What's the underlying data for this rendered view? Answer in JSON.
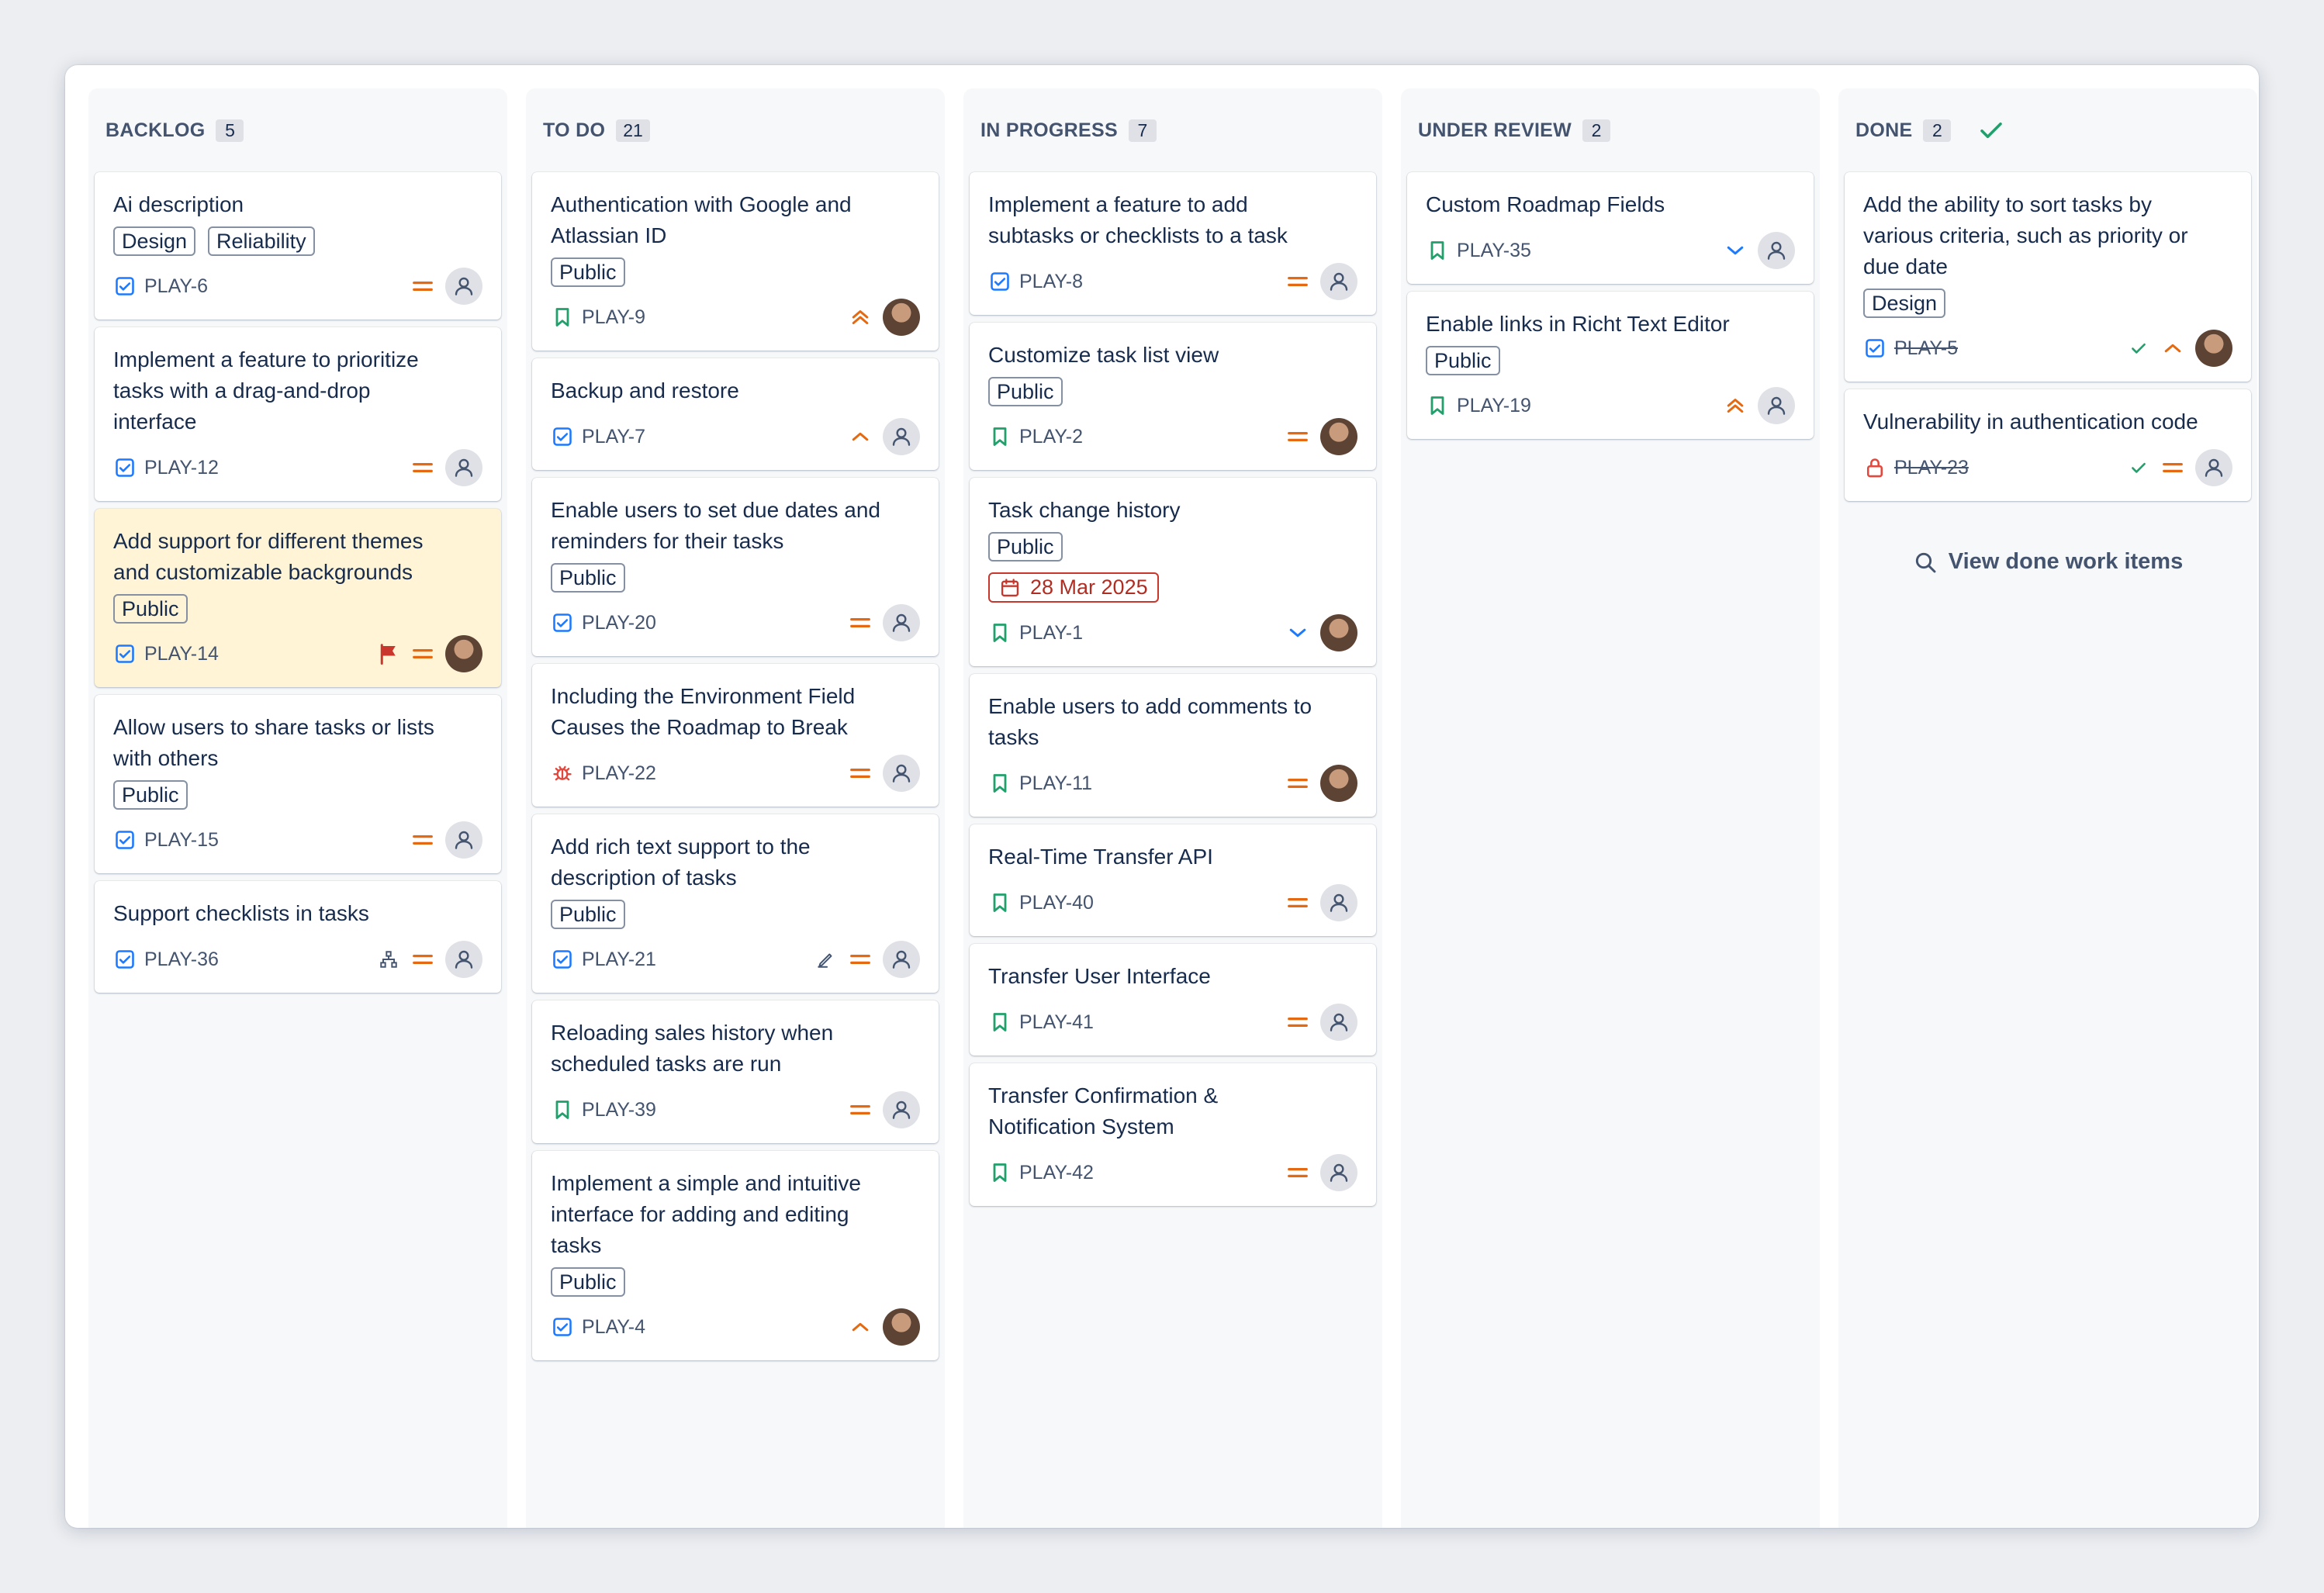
{
  "colors": {
    "priority_medium": "#e56910",
    "priority_high": "#e56910",
    "priority_low": "#1d7afc",
    "flag": "#c9372c",
    "task_icon": "#1d7afc",
    "story_icon": "#22a06b",
    "bug_icon": "#e2483d"
  },
  "columns": [
    {
      "title": "BACKLOG",
      "count": "5",
      "cards": [
        {
          "title": "Ai description",
          "labels": [
            "Design",
            "Reliability"
          ],
          "key": "PLAY-6",
          "type": "task",
          "priority": "medium",
          "avatar": "empty"
        },
        {
          "title": "Implement a feature to prioritize tasks with a drag-and-drop interface",
          "labels": [],
          "key": "PLAY-12",
          "type": "task",
          "priority": "medium",
          "avatar": "empty"
        },
        {
          "title": "Add support for different themes and customizable backgrounds",
          "labels": [
            "Public"
          ],
          "key": "PLAY-14",
          "type": "task",
          "priority": "medium",
          "avatar": "photo",
          "flagged": true,
          "highlight": true
        },
        {
          "title": "Allow users to share tasks or lists with others",
          "labels": [
            "Public"
          ],
          "key": "PLAY-15",
          "type": "task",
          "priority": "medium",
          "avatar": "empty"
        },
        {
          "title": "Support checklists in tasks",
          "labels": [],
          "key": "PLAY-36",
          "type": "task",
          "priority": "medium",
          "avatar": "empty",
          "child_icon": true
        }
      ]
    },
    {
      "title": "TO DO",
      "count": "21",
      "cards": [
        {
          "title": "Authentication with Google and Atlassian ID",
          "labels": [
            "Public"
          ],
          "key": "PLAY-9",
          "type": "story",
          "priority": "high",
          "avatar": "photo"
        },
        {
          "title": "Backup and restore",
          "labels": [],
          "key": "PLAY-7",
          "type": "task",
          "priority": "up",
          "avatar": "empty"
        },
        {
          "title": "Enable users to set due dates and reminders for their tasks",
          "labels": [
            "Public"
          ],
          "key": "PLAY-20",
          "type": "task",
          "priority": "medium",
          "avatar": "empty"
        },
        {
          "title": "Including the Environment Field Causes the Roadmap to Break",
          "labels": [],
          "key": "PLAY-22",
          "type": "bug",
          "priority": "medium",
          "avatar": "empty"
        },
        {
          "title": "Add rich text support to the description of tasks",
          "labels": [
            "Public"
          ],
          "key": "PLAY-21",
          "type": "task",
          "priority": "medium",
          "avatar": "empty",
          "edit_icon": true
        },
        {
          "title": "Reloading sales history when scheduled tasks are run",
          "labels": [],
          "key": "PLAY-39",
          "type": "story",
          "priority": "medium",
          "avatar": "empty"
        },
        {
          "title": "Implement a simple and intuitive interface for adding and editing tasks",
          "labels": [
            "Public"
          ],
          "key": "PLAY-4",
          "type": "task",
          "priority": "up",
          "avatar": "photo"
        }
      ]
    },
    {
      "title": "IN PROGRESS",
      "count": "7",
      "cards": [
        {
          "title": "Implement a feature to add subtasks or checklists to a task",
          "labels": [],
          "key": "PLAY-8",
          "type": "task",
          "priority": "medium",
          "avatar": "empty"
        },
        {
          "title": "Customize task list view",
          "labels": [
            "Public"
          ],
          "key": "PLAY-2",
          "type": "story",
          "priority": "medium",
          "avatar": "photo"
        },
        {
          "title": "Task change history",
          "labels": [
            "Public"
          ],
          "key": "PLAY-1",
          "type": "story",
          "priority": "low",
          "avatar": "photo",
          "due_date": "28 Mar 2025"
        },
        {
          "title": "Enable users to add comments to tasks",
          "labels": [],
          "key": "PLAY-11",
          "type": "story",
          "priority": "medium",
          "avatar": "photo"
        },
        {
          "title": "Real-Time Transfer API",
          "labels": [],
          "key": "PLAY-40",
          "type": "story",
          "priority": "medium",
          "avatar": "empty"
        },
        {
          "title": "Transfer User Interface",
          "labels": [],
          "key": "PLAY-41",
          "type": "story",
          "priority": "medium",
          "avatar": "empty"
        },
        {
          "title": "Transfer Confirmation & Notification System",
          "labels": [],
          "key": "PLAY-42",
          "type": "story",
          "priority": "medium",
          "avatar": "empty"
        }
      ]
    },
    {
      "title": "UNDER REVIEW",
      "count": "2",
      "cards": [
        {
          "title": "Custom Roadmap Fields",
          "labels": [],
          "key": "PLAY-35",
          "type": "story",
          "priority": "low",
          "avatar": "empty"
        },
        {
          "title": "Enable links in Richt Text Editor",
          "labels": [
            "Public"
          ],
          "key": "PLAY-19",
          "type": "story",
          "priority": "high",
          "avatar": "empty"
        }
      ]
    },
    {
      "title": "DONE",
      "count": "2",
      "done": true,
      "cards": [
        {
          "title": "Add the ability to sort tasks by various criteria, such as priority or due date",
          "labels": [
            "Design"
          ],
          "key": "PLAY-5",
          "type": "task",
          "priority": "up",
          "avatar": "photo",
          "resolved": true
        },
        {
          "title": "Vulnerability in authentication code",
          "labels": [],
          "key": "PLAY-23",
          "type": "lock",
          "priority": "medium",
          "avatar": "empty",
          "resolved": true
        }
      ],
      "view_done_label": "View done work items"
    }
  ]
}
